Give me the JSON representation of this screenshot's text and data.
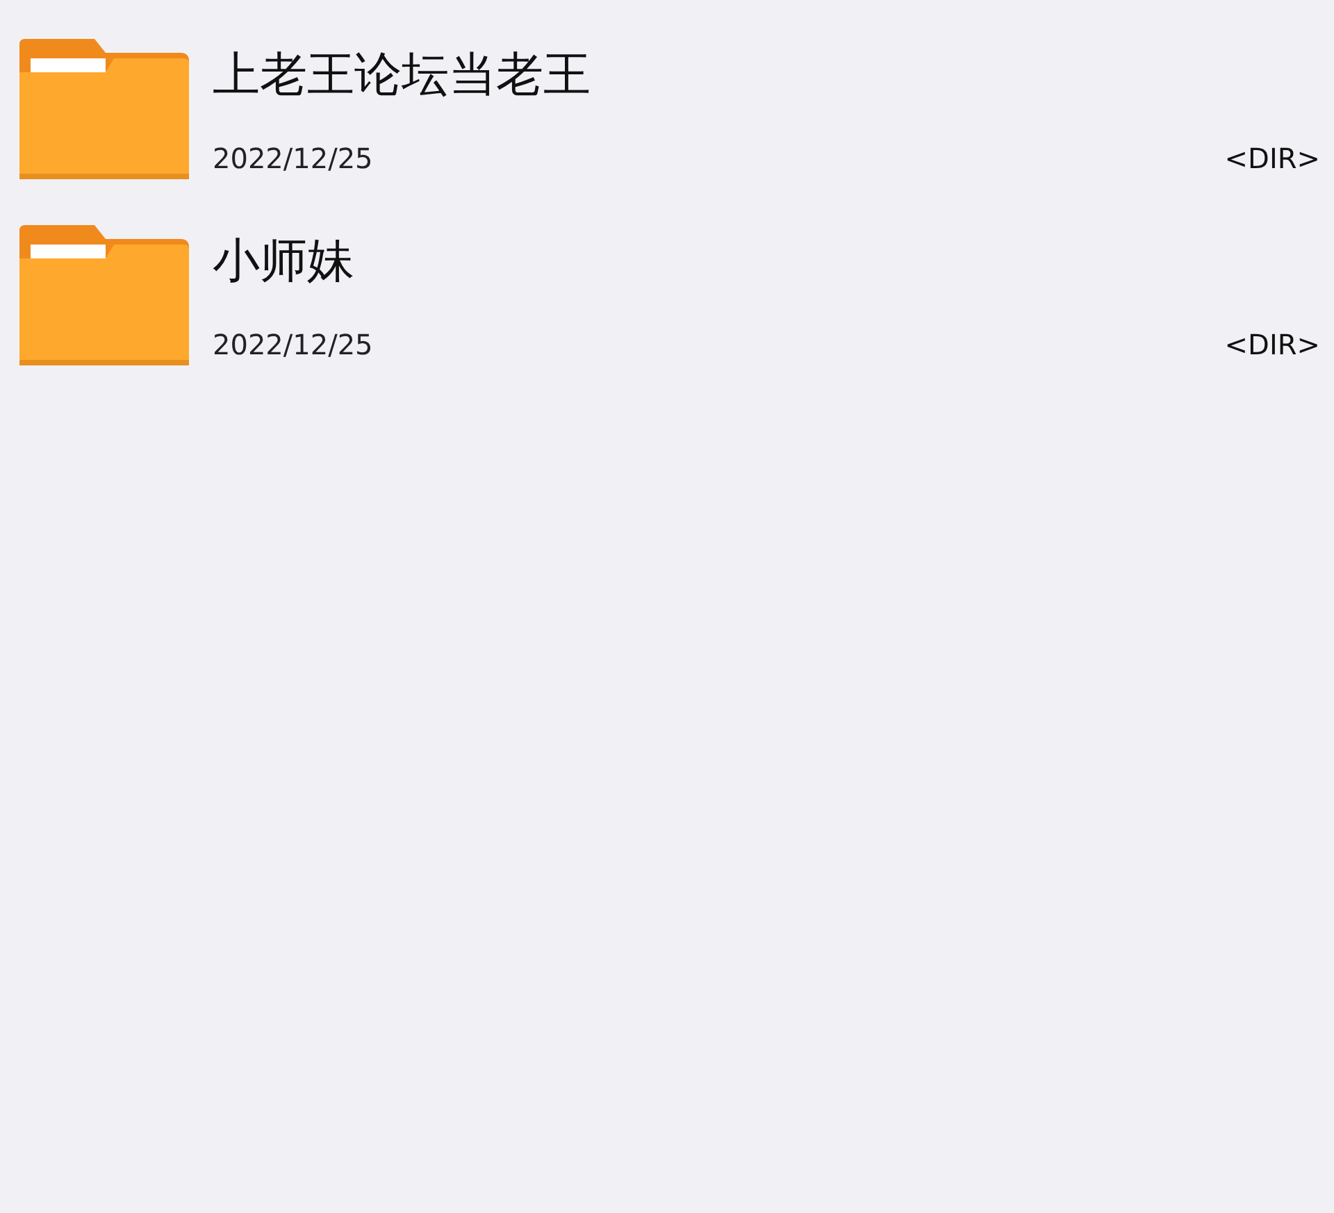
{
  "files": [
    {
      "kind": "folder",
      "name": "上老王论坛当老王",
      "date": "2022/12/25",
      "type": "<DIR>"
    },
    {
      "kind": "folder",
      "name": "小师妹",
      "date": "2022/12/25",
      "type": "<DIR>"
    }
  ]
}
